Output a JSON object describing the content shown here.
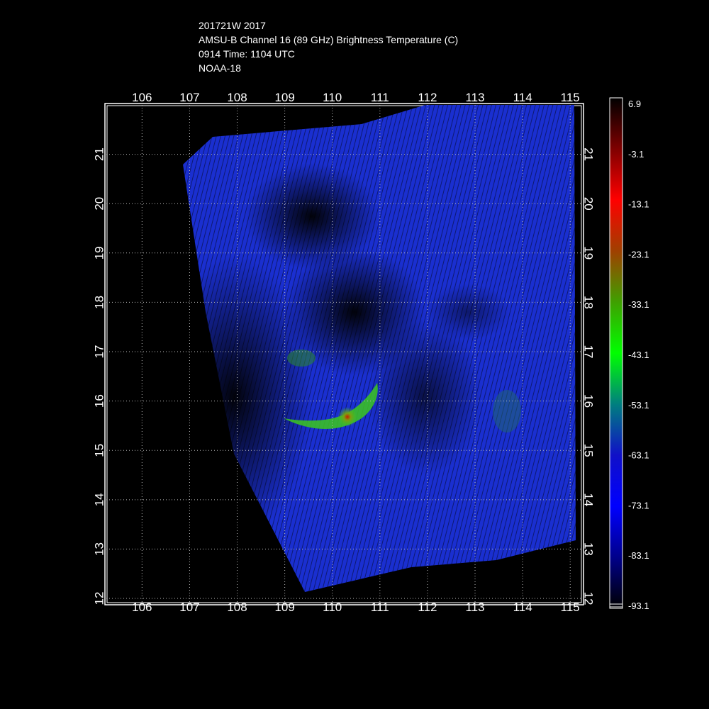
{
  "header": {
    "storm": "201721W 2017",
    "product": "AMSU-B Channel 16 (89 GHz) Brightness Temperature (C)",
    "time": "0914 Time: 1104 UTC",
    "satellite": "NOAA-18"
  },
  "map": {
    "lon_range": [
      105.25,
      115.25
    ],
    "lat_range": [
      11.9,
      22.0
    ],
    "lon_ticks": [
      "106",
      "107",
      "108",
      "109",
      "110",
      "111",
      "112",
      "113",
      "114",
      "115"
    ],
    "lat_ticks": [
      "12",
      "13",
      "14",
      "15",
      "16",
      "17",
      "18",
      "19",
      "20",
      "21"
    ],
    "grid": "dotted",
    "swath_color": "#1a2fd0",
    "warm_color": "#000000",
    "cold_band_color": "#3cc81e",
    "coldest_color": "#c81e00"
  },
  "colorbar": {
    "labels": [
      "6.9",
      "-3.1",
      "-13.1",
      "-23.1",
      "-33.1",
      "-43.1",
      "-53.1",
      "-63.1",
      "-73.1",
      "-83.1",
      "-93.1"
    ],
    "stops": [
      "#000000",
      "#00008b",
      "#0000ff",
      "#1010c8",
      "#007f7f",
      "#00ff00",
      "#3fa000",
      "#a04000",
      "#ff0000",
      "#7f0000",
      "#000000"
    ]
  }
}
